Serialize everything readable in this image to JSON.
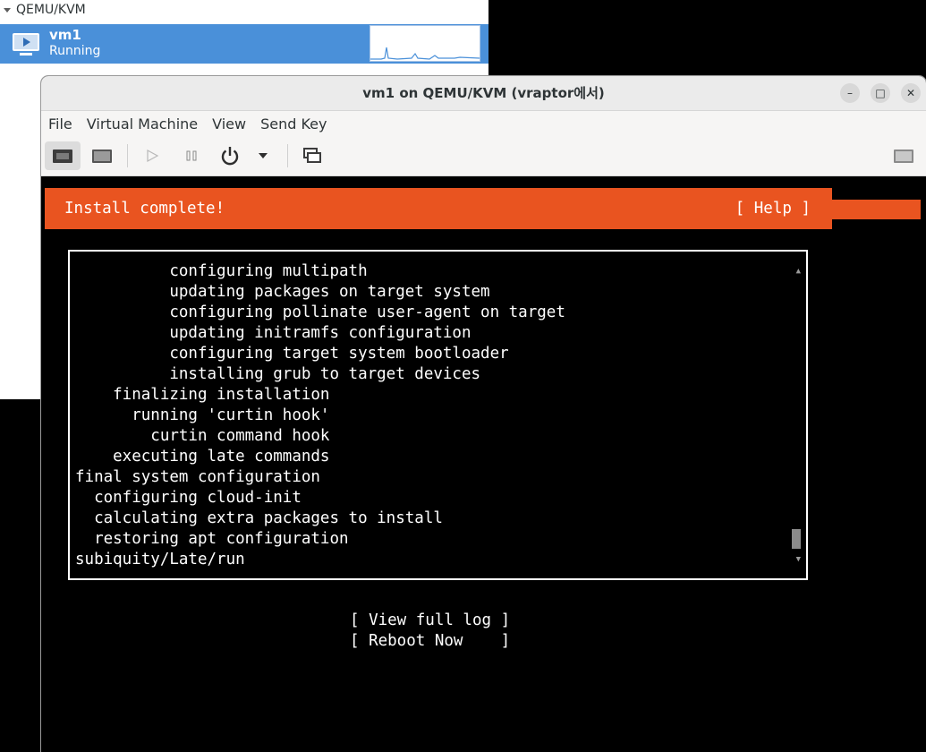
{
  "manager": {
    "group": "QEMU/KVM",
    "vm_name": "vm1",
    "vm_status": "Running"
  },
  "window": {
    "title": "vm1 on QEMU/KVM (vraptor에서)",
    "minimize_glyph": "–",
    "maximize_glyph": "□",
    "close_glyph": "✕"
  },
  "menus": [
    "File",
    "Virtual Machine",
    "View",
    "Send Key"
  ],
  "toolbar": {
    "icons": [
      "console-monitor-icon",
      "details-icon",
      "run-icon",
      "pause-icon",
      "power-icon",
      "chevron-down-icon",
      "snapshots-icon",
      "fullscreen-icon"
    ]
  },
  "installer": {
    "header_title": "Install complete!",
    "help_label": "[ Help ]",
    "log_lines": [
      "          configuring multipath",
      "          updating packages on target system",
      "          configuring pollinate user-agent on target",
      "          updating initramfs configuration",
      "          configuring target system bootloader",
      "          installing grub to target devices",
      "    finalizing installation",
      "      running 'curtin hook'",
      "        curtin command hook",
      "    executing late commands",
      "final system configuration",
      "  configuring cloud-init",
      "  calculating extra packages to install",
      "  restoring apt configuration",
      "subiquity/Late/run"
    ],
    "scroll_up_glyph": "▲",
    "scroll_down_glyph": "▼",
    "view_log_label": "[ View full log ]",
    "reboot_label": "[ Reboot Now    ]"
  },
  "colors": {
    "accent": "#e95420",
    "selection": "#4a90d9"
  }
}
